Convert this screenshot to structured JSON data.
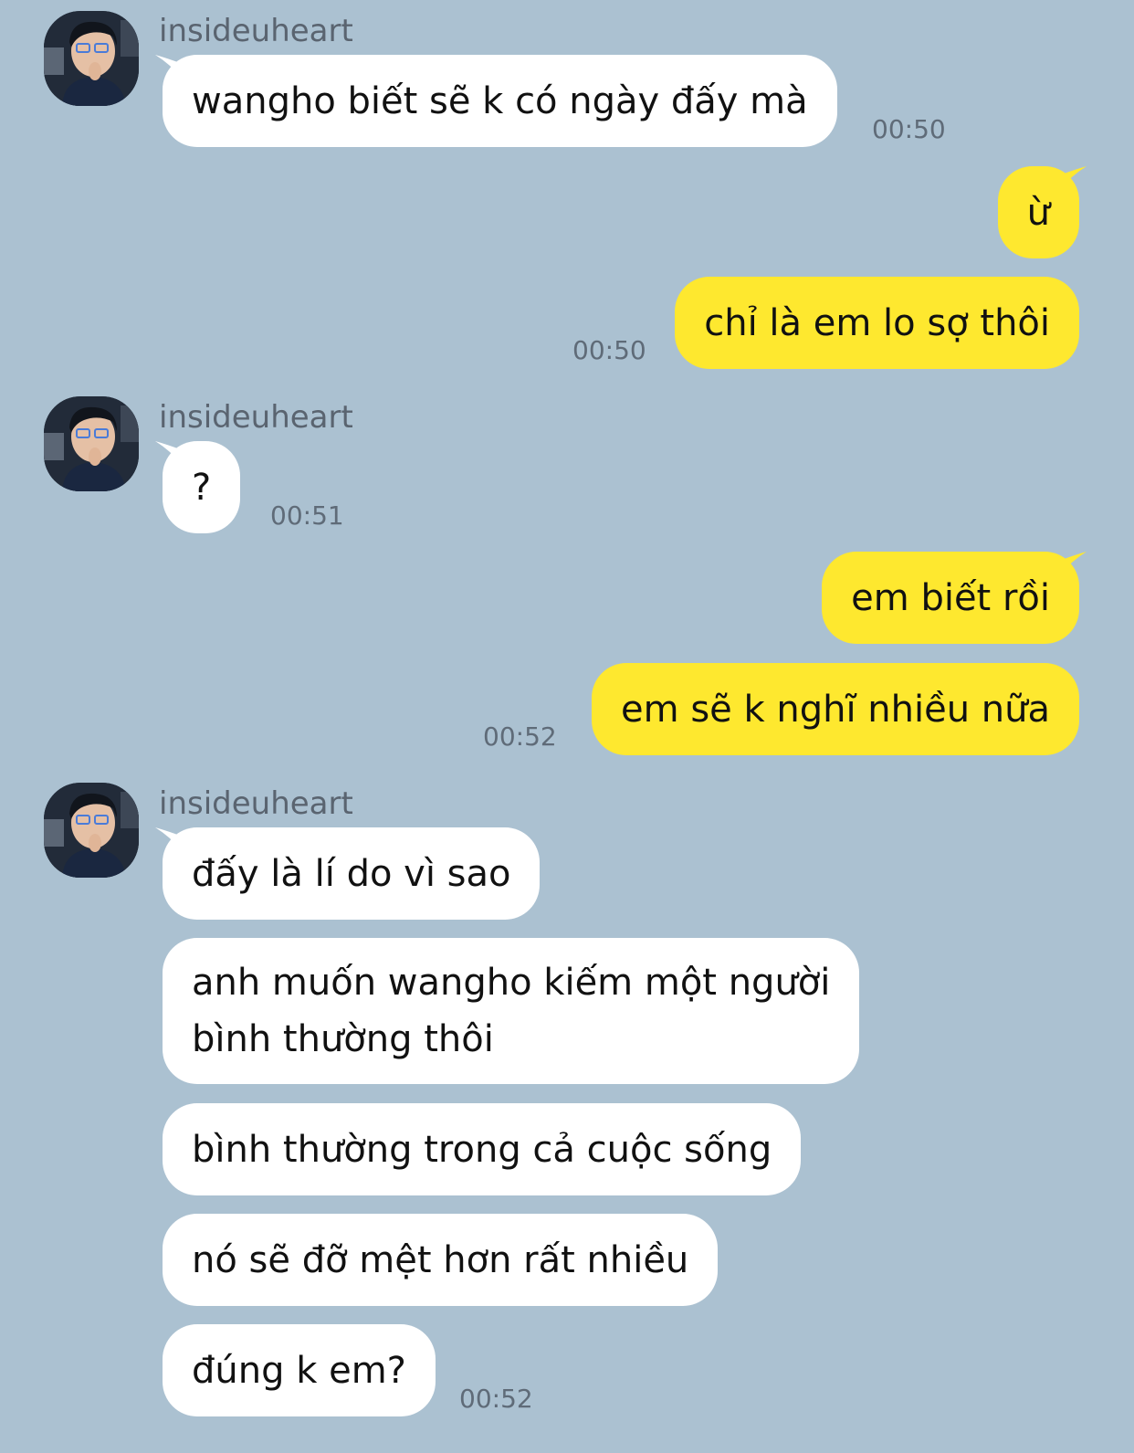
{
  "colors": {
    "background": "#abc1d1",
    "incoming_bubble": "#ffffff",
    "outgoing_bubble": "#fee82f"
  },
  "messages": {
    "g1": {
      "sender": "insideuheart",
      "m1": "wangho biết sẽ k có ngày đấy mà",
      "time": "00:50"
    },
    "g2": {
      "m1": "ừ",
      "m2": "chỉ là em lo sợ thôi",
      "time": "00:50"
    },
    "g3": {
      "sender": "insideuheart",
      "m1": "?",
      "time": "00:51"
    },
    "g4": {
      "m1": "em biết rồi",
      "m2": "em sẽ k nghĩ nhiều nữa",
      "time": "00:52"
    },
    "g5": {
      "sender": "insideuheart",
      "m1": "đấy là lí do vì sao",
      "m2_line1": "anh muốn wangho kiếm một người",
      "m2_line2": "bình thường thôi",
      "m3": "bình thường trong cả cuộc sống",
      "m4": "nó sẽ đỡ mệt hơn rất nhiều",
      "m5": "đúng k em?",
      "time": "00:52"
    }
  }
}
